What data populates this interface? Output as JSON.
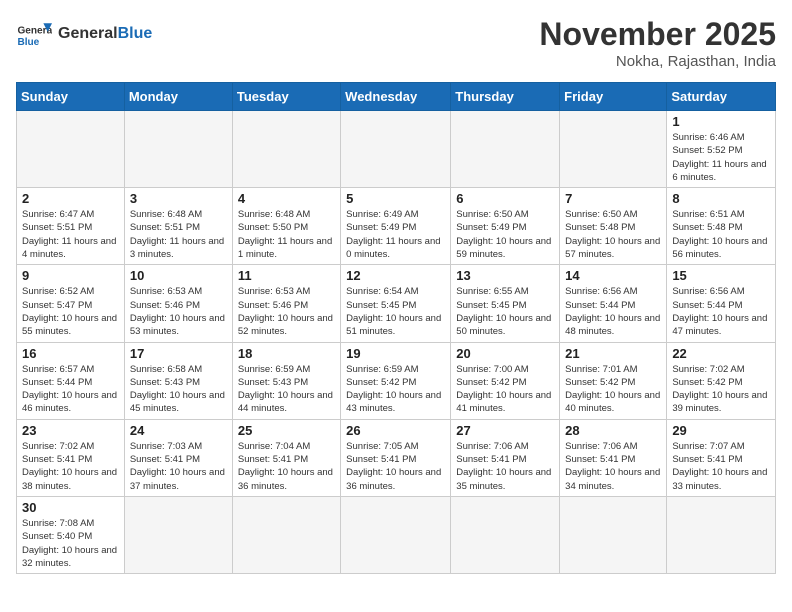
{
  "header": {
    "logo_general": "General",
    "logo_blue": "Blue",
    "month_title": "November 2025",
    "location": "Nokha, Rajasthan, India"
  },
  "weekdays": [
    "Sunday",
    "Monday",
    "Tuesday",
    "Wednesday",
    "Thursday",
    "Friday",
    "Saturday"
  ],
  "weeks": [
    [
      {
        "day": "",
        "info": ""
      },
      {
        "day": "",
        "info": ""
      },
      {
        "day": "",
        "info": ""
      },
      {
        "day": "",
        "info": ""
      },
      {
        "day": "",
        "info": ""
      },
      {
        "day": "",
        "info": ""
      },
      {
        "day": "1",
        "info": "Sunrise: 6:46 AM\nSunset: 5:52 PM\nDaylight: 11 hours and 6 minutes."
      }
    ],
    [
      {
        "day": "2",
        "info": "Sunrise: 6:47 AM\nSunset: 5:51 PM\nDaylight: 11 hours and 4 minutes."
      },
      {
        "day": "3",
        "info": "Sunrise: 6:48 AM\nSunset: 5:51 PM\nDaylight: 11 hours and 3 minutes."
      },
      {
        "day": "4",
        "info": "Sunrise: 6:48 AM\nSunset: 5:50 PM\nDaylight: 11 hours and 1 minute."
      },
      {
        "day": "5",
        "info": "Sunrise: 6:49 AM\nSunset: 5:49 PM\nDaylight: 11 hours and 0 minutes."
      },
      {
        "day": "6",
        "info": "Sunrise: 6:50 AM\nSunset: 5:49 PM\nDaylight: 10 hours and 59 minutes."
      },
      {
        "day": "7",
        "info": "Sunrise: 6:50 AM\nSunset: 5:48 PM\nDaylight: 10 hours and 57 minutes."
      },
      {
        "day": "8",
        "info": "Sunrise: 6:51 AM\nSunset: 5:48 PM\nDaylight: 10 hours and 56 minutes."
      }
    ],
    [
      {
        "day": "9",
        "info": "Sunrise: 6:52 AM\nSunset: 5:47 PM\nDaylight: 10 hours and 55 minutes."
      },
      {
        "day": "10",
        "info": "Sunrise: 6:53 AM\nSunset: 5:46 PM\nDaylight: 10 hours and 53 minutes."
      },
      {
        "day": "11",
        "info": "Sunrise: 6:53 AM\nSunset: 5:46 PM\nDaylight: 10 hours and 52 minutes."
      },
      {
        "day": "12",
        "info": "Sunrise: 6:54 AM\nSunset: 5:45 PM\nDaylight: 10 hours and 51 minutes."
      },
      {
        "day": "13",
        "info": "Sunrise: 6:55 AM\nSunset: 5:45 PM\nDaylight: 10 hours and 50 minutes."
      },
      {
        "day": "14",
        "info": "Sunrise: 6:56 AM\nSunset: 5:44 PM\nDaylight: 10 hours and 48 minutes."
      },
      {
        "day": "15",
        "info": "Sunrise: 6:56 AM\nSunset: 5:44 PM\nDaylight: 10 hours and 47 minutes."
      }
    ],
    [
      {
        "day": "16",
        "info": "Sunrise: 6:57 AM\nSunset: 5:44 PM\nDaylight: 10 hours and 46 minutes."
      },
      {
        "day": "17",
        "info": "Sunrise: 6:58 AM\nSunset: 5:43 PM\nDaylight: 10 hours and 45 minutes."
      },
      {
        "day": "18",
        "info": "Sunrise: 6:59 AM\nSunset: 5:43 PM\nDaylight: 10 hours and 44 minutes."
      },
      {
        "day": "19",
        "info": "Sunrise: 6:59 AM\nSunset: 5:42 PM\nDaylight: 10 hours and 43 minutes."
      },
      {
        "day": "20",
        "info": "Sunrise: 7:00 AM\nSunset: 5:42 PM\nDaylight: 10 hours and 41 minutes."
      },
      {
        "day": "21",
        "info": "Sunrise: 7:01 AM\nSunset: 5:42 PM\nDaylight: 10 hours and 40 minutes."
      },
      {
        "day": "22",
        "info": "Sunrise: 7:02 AM\nSunset: 5:42 PM\nDaylight: 10 hours and 39 minutes."
      }
    ],
    [
      {
        "day": "23",
        "info": "Sunrise: 7:02 AM\nSunset: 5:41 PM\nDaylight: 10 hours and 38 minutes."
      },
      {
        "day": "24",
        "info": "Sunrise: 7:03 AM\nSunset: 5:41 PM\nDaylight: 10 hours and 37 minutes."
      },
      {
        "day": "25",
        "info": "Sunrise: 7:04 AM\nSunset: 5:41 PM\nDaylight: 10 hours and 36 minutes."
      },
      {
        "day": "26",
        "info": "Sunrise: 7:05 AM\nSunset: 5:41 PM\nDaylight: 10 hours and 36 minutes."
      },
      {
        "day": "27",
        "info": "Sunrise: 7:06 AM\nSunset: 5:41 PM\nDaylight: 10 hours and 35 minutes."
      },
      {
        "day": "28",
        "info": "Sunrise: 7:06 AM\nSunset: 5:41 PM\nDaylight: 10 hours and 34 minutes."
      },
      {
        "day": "29",
        "info": "Sunrise: 7:07 AM\nSunset: 5:41 PM\nDaylight: 10 hours and 33 minutes."
      }
    ],
    [
      {
        "day": "30",
        "info": "Sunrise: 7:08 AM\nSunset: 5:40 PM\nDaylight: 10 hours and 32 minutes."
      },
      {
        "day": "",
        "info": ""
      },
      {
        "day": "",
        "info": ""
      },
      {
        "day": "",
        "info": ""
      },
      {
        "day": "",
        "info": ""
      },
      {
        "day": "",
        "info": ""
      },
      {
        "day": "",
        "info": ""
      }
    ]
  ]
}
